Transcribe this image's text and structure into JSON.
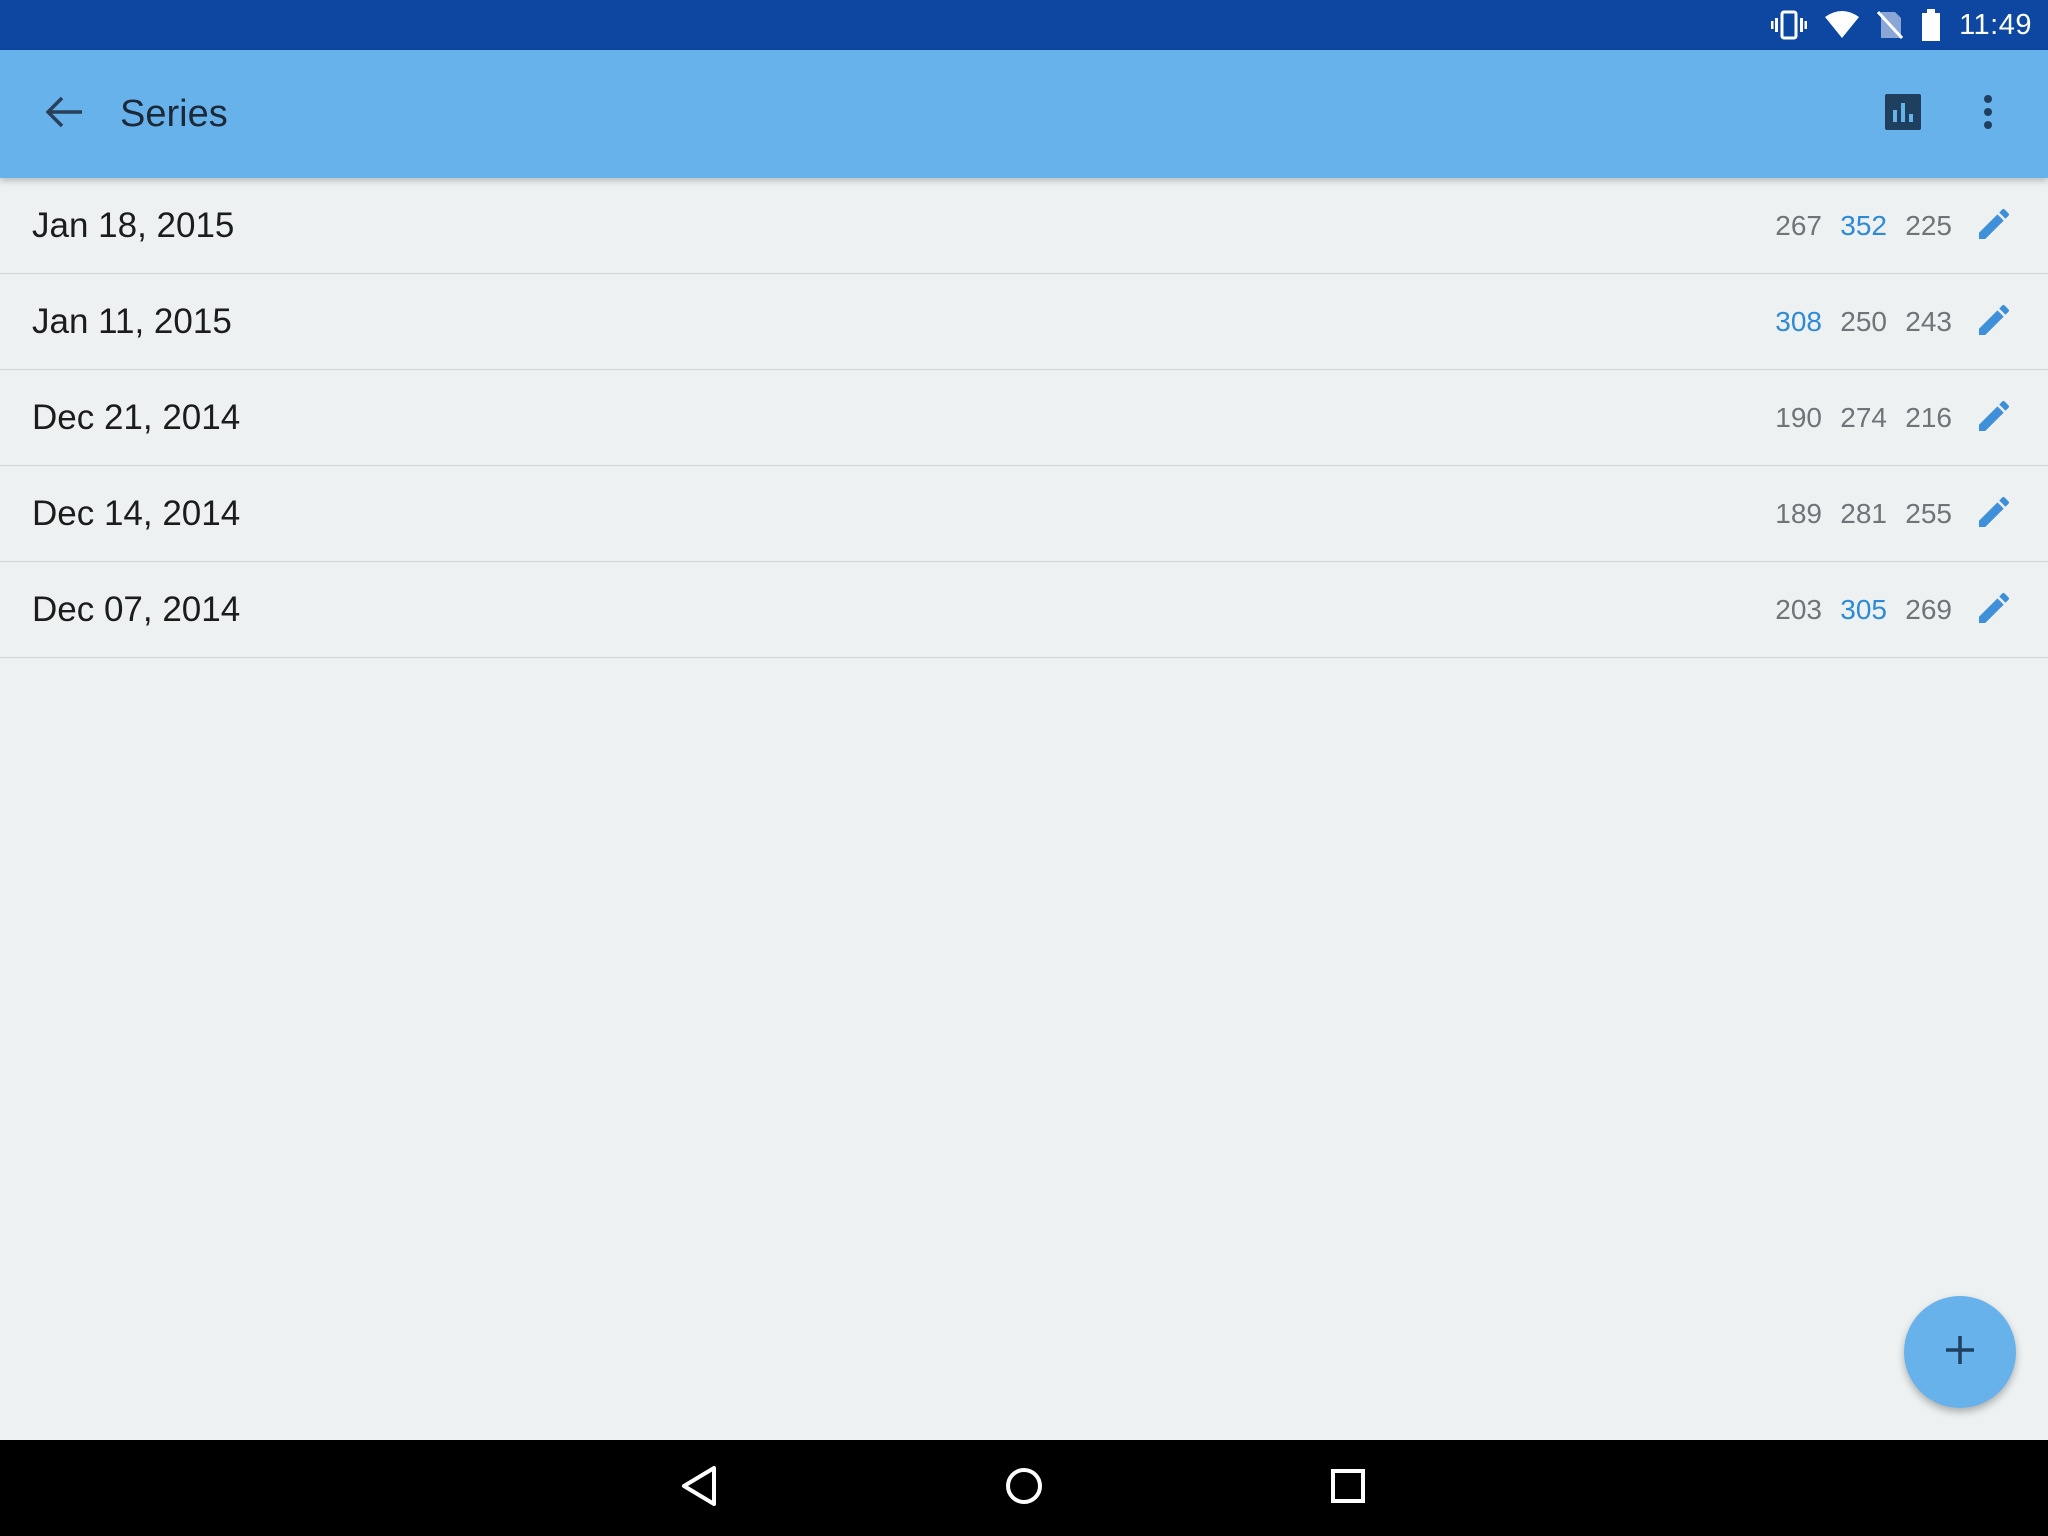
{
  "status_bar": {
    "time": "11:49",
    "icons": [
      "vibrate-icon",
      "wifi-icon",
      "no-sim-icon",
      "battery-icon"
    ]
  },
  "app_bar": {
    "title": "Series",
    "color": "#68b2ec",
    "actions": [
      "back-arrow-icon",
      "bar-chart-icon",
      "more-vert-icon"
    ]
  },
  "series": [
    {
      "date": "Jan 18, 2015",
      "scores": [
        "267",
        "352",
        "225"
      ],
      "highlight": [
        false,
        true,
        false
      ]
    },
    {
      "date": "Jan 11, 2015",
      "scores": [
        "308",
        "250",
        "243"
      ],
      "highlight": [
        true,
        false,
        false
      ]
    },
    {
      "date": "Dec 21, 2014",
      "scores": [
        "190",
        "274",
        "216"
      ],
      "highlight": [
        false,
        false,
        false
      ]
    },
    {
      "date": "Dec 14, 2014",
      "scores": [
        "189",
        "281",
        "255"
      ],
      "highlight": [
        false,
        false,
        false
      ]
    },
    {
      "date": "Dec 07, 2014",
      "scores": [
        "203",
        "305",
        "269"
      ],
      "highlight": [
        false,
        true,
        false
      ]
    }
  ],
  "colors": {
    "status_bar": "#0d47a1",
    "accent": "#2f8ad6",
    "background": "#edf1f2"
  },
  "fab": {
    "icon": "plus-icon"
  },
  "nav_bar": {
    "icons": [
      "nav-back-icon",
      "nav-home-icon",
      "nav-recents-icon"
    ]
  }
}
